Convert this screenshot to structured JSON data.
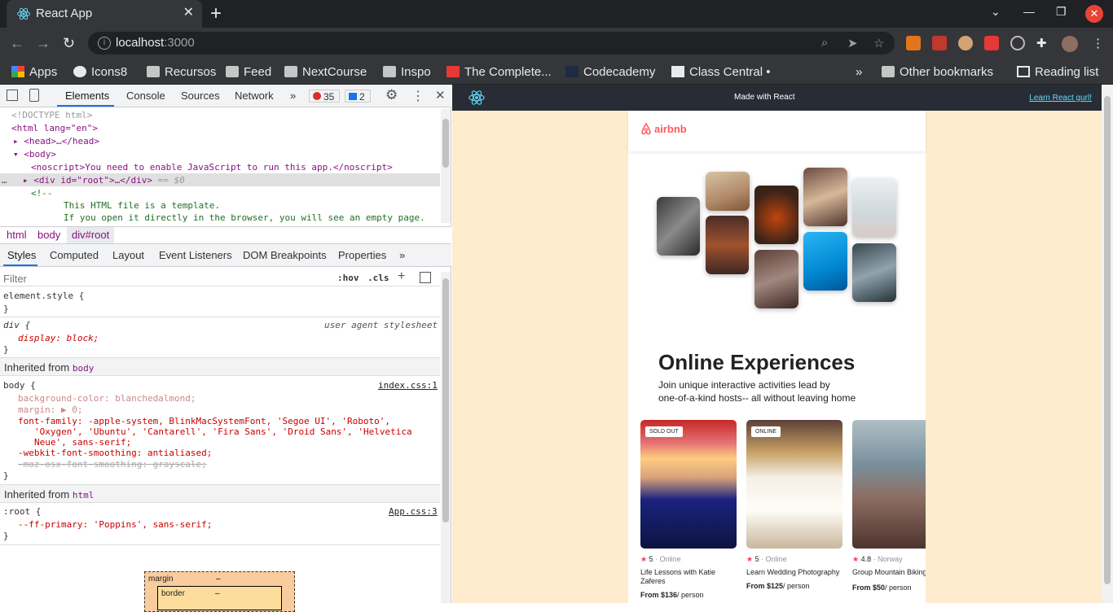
{
  "browser": {
    "tab_title": "React App",
    "url_host": "localhost",
    "url_port": ":3000",
    "bookmarks": [
      "Apps",
      "Icons8",
      "Recursos",
      "Feed",
      "NextCourse",
      "Inspo",
      "The Complete...",
      "Codecademy",
      "Class Central •"
    ],
    "more": "»",
    "other_bookmarks": "Other bookmarks",
    "reading_list": "Reading list"
  },
  "devtools": {
    "tabs": [
      "Elements",
      "Console",
      "Sources",
      "Network"
    ],
    "more": "»",
    "errors": "35",
    "messages": "2",
    "dom": {
      "doctype": "<!DOCTYPE html>",
      "html_open": "<html lang=\"en\">",
      "head": "<head>…</head>",
      "body_open": "<body>",
      "noscript": "<noscript>You need to enable JavaScript to run this app.</noscript>",
      "root": "<div id=\"root\">…</div>",
      "root_eq": "== $0",
      "comment_open": "<!--",
      "comment_l1": "This HTML file is a template.",
      "comment_l2": "If you open it directly in the browser, you will see an empty page."
    },
    "breadcrumbs": [
      "html",
      "body",
      "div#root"
    ],
    "style_tabs": [
      "Styles",
      "Computed",
      "Layout",
      "Event Listeners",
      "DOM Breakpoints",
      "Properties"
    ],
    "filter_placeholder": "Filter",
    "hov": ":hov",
    "cls": ".cls",
    "element_style": "element.style {",
    "close_brace": "}",
    "ua_rule": "div {",
    "ua_label": "user agent stylesheet",
    "ua_decl": "display: block;",
    "inherited_body": "Inherited from",
    "body_tag": "body",
    "body_rule": "body {",
    "body_src": "index.css:1",
    "body_decls": [
      "background-color: blanchedalmond;",
      "margin: ▶ 0;",
      "font-family: -apple-system, BlinkMacSystemFont, 'Segoe UI', 'Roboto',",
      "'Oxygen', 'Ubuntu', 'Cantarell', 'Fira Sans', 'Droid Sans', 'Helvetica",
      "Neue', sans-serif;",
      "-webkit-font-smoothing: antialiased;",
      "-moz-osx-font-smoothing: grayscale;"
    ],
    "html_tag": "html",
    "root_rule": ":root {",
    "root_src": "App.css:3",
    "root_decl": "--ff-primary: 'Poppins', sans-serif;",
    "box_margin": "margin",
    "box_border": "border",
    "box_dash": "–"
  },
  "react_bar": {
    "center": "Made with React",
    "link": "Learn React gurl!"
  },
  "app": {
    "logo": "airbnb",
    "hero_title": "Online Experiences",
    "hero_sub_1": "Join unique interactive activities lead by",
    "hero_sub_2": "one-of-a-kind hosts-- all without leaving home",
    "cards": [
      {
        "badge": "SOLD OUT",
        "rating": "5",
        "location": "Online",
        "title": "Life Lessons with Katie Zaferes",
        "price": "From $136",
        "per": "/ person"
      },
      {
        "badge": "ONLINE",
        "rating": "5",
        "location": "Online",
        "title": "Learn Wedding Photography",
        "price": "From $125",
        "per": "/ person"
      },
      {
        "badge": "",
        "rating": "4.8",
        "location": "Norway",
        "title": "Group Mountain Biking",
        "price": "From $50",
        "per": "/ person"
      }
    ]
  },
  "colors": {
    "accent": "#fe395c",
    "page_bg": "#ffebcd",
    "react": "#61dafb"
  }
}
